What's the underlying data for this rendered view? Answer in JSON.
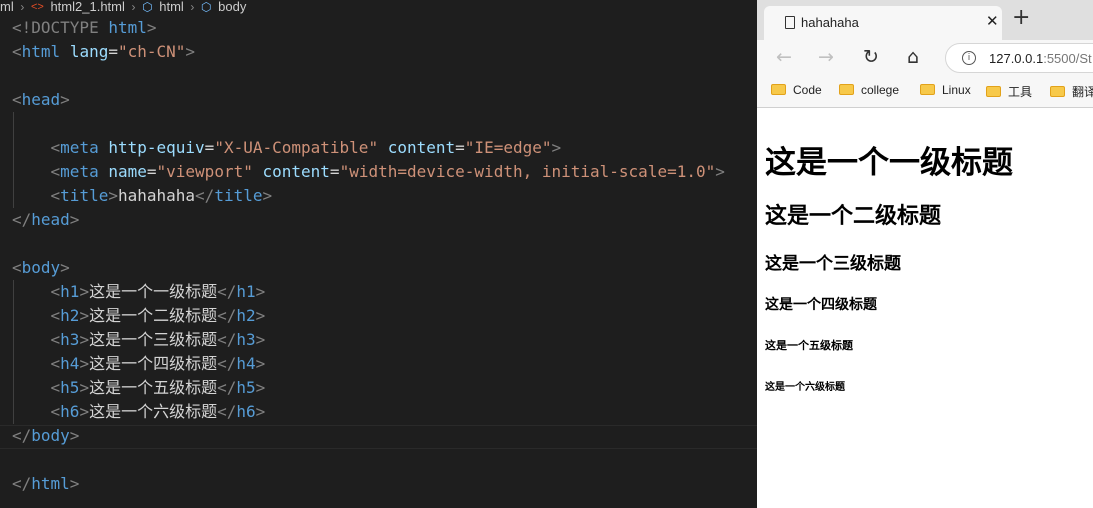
{
  "editor": {
    "breadcrumb": {
      "root": "ml",
      "file": "html2_1.html",
      "html": "html",
      "body": "body"
    },
    "lines": [
      [
        {
          "c": "t-br",
          "t": "<!DOCTYPE "
        },
        {
          "c": "t-tag",
          "t": "html"
        },
        {
          "c": "t-br",
          "t": ">"
        }
      ],
      [
        {
          "c": "t-br",
          "t": "<"
        },
        {
          "c": "t-tag",
          "t": "html"
        },
        {
          "c": "t-text",
          "t": " "
        },
        {
          "c": "t-attr",
          "t": "lang"
        },
        {
          "c": "t-text",
          "t": "="
        },
        {
          "c": "t-str",
          "t": "\"ch-CN\""
        },
        {
          "c": "t-br",
          "t": ">"
        }
      ],
      [],
      [
        {
          "c": "t-br",
          "t": "<"
        },
        {
          "c": "t-tag",
          "t": "head"
        },
        {
          "c": "t-br",
          "t": ">"
        }
      ],
      [],
      [
        {
          "c": "t-text",
          "t": "    "
        },
        {
          "c": "t-br",
          "t": "<"
        },
        {
          "c": "t-tag",
          "t": "meta"
        },
        {
          "c": "t-text",
          "t": " "
        },
        {
          "c": "t-attr",
          "t": "http-equiv"
        },
        {
          "c": "t-text",
          "t": "="
        },
        {
          "c": "t-str",
          "t": "\"X-UA-Compatible\""
        },
        {
          "c": "t-text",
          "t": " "
        },
        {
          "c": "t-attr",
          "t": "content"
        },
        {
          "c": "t-text",
          "t": "="
        },
        {
          "c": "t-str",
          "t": "\"IE=edge\""
        },
        {
          "c": "t-br",
          "t": ">"
        }
      ],
      [
        {
          "c": "t-text",
          "t": "    "
        },
        {
          "c": "t-br",
          "t": "<"
        },
        {
          "c": "t-tag",
          "t": "meta"
        },
        {
          "c": "t-text",
          "t": " "
        },
        {
          "c": "t-attr",
          "t": "name"
        },
        {
          "c": "t-text",
          "t": "="
        },
        {
          "c": "t-str",
          "t": "\"viewport\""
        },
        {
          "c": "t-text",
          "t": " "
        },
        {
          "c": "t-attr",
          "t": "content"
        },
        {
          "c": "t-text",
          "t": "="
        },
        {
          "c": "t-str",
          "t": "\"width=device-width, initial-scale=1.0\""
        },
        {
          "c": "t-br",
          "t": ">"
        }
      ],
      [
        {
          "c": "t-text",
          "t": "    "
        },
        {
          "c": "t-br",
          "t": "<"
        },
        {
          "c": "t-tag",
          "t": "title"
        },
        {
          "c": "t-br",
          "t": ">"
        },
        {
          "c": "t-text",
          "t": "hahahaha"
        },
        {
          "c": "t-br",
          "t": "</"
        },
        {
          "c": "t-tag",
          "t": "title"
        },
        {
          "c": "t-br",
          "t": ">"
        }
      ],
      [
        {
          "c": "t-br",
          "t": "</"
        },
        {
          "c": "t-tag",
          "t": "head"
        },
        {
          "c": "t-br",
          "t": ">"
        }
      ],
      [],
      [
        {
          "c": "t-br",
          "t": "<"
        },
        {
          "c": "t-tag",
          "t": "body"
        },
        {
          "c": "t-br",
          "t": ">"
        }
      ],
      [
        {
          "c": "t-text",
          "t": "    "
        },
        {
          "c": "t-br",
          "t": "<"
        },
        {
          "c": "t-tag",
          "t": "h1"
        },
        {
          "c": "t-br",
          "t": ">"
        },
        {
          "c": "t-text",
          "t": "这是一个一级标题"
        },
        {
          "c": "t-br",
          "t": "</"
        },
        {
          "c": "t-tag",
          "t": "h1"
        },
        {
          "c": "t-br",
          "t": ">"
        }
      ],
      [
        {
          "c": "t-text",
          "t": "    "
        },
        {
          "c": "t-br",
          "t": "<"
        },
        {
          "c": "t-tag",
          "t": "h2"
        },
        {
          "c": "t-br",
          "t": ">"
        },
        {
          "c": "t-text",
          "t": "这是一个二级标题"
        },
        {
          "c": "t-br",
          "t": "</"
        },
        {
          "c": "t-tag",
          "t": "h2"
        },
        {
          "c": "t-br",
          "t": ">"
        }
      ],
      [
        {
          "c": "t-text",
          "t": "    "
        },
        {
          "c": "t-br",
          "t": "<"
        },
        {
          "c": "t-tag",
          "t": "h3"
        },
        {
          "c": "t-br",
          "t": ">"
        },
        {
          "c": "t-text",
          "t": "这是一个三级标题"
        },
        {
          "c": "t-br",
          "t": "</"
        },
        {
          "c": "t-tag",
          "t": "h3"
        },
        {
          "c": "t-br",
          "t": ">"
        }
      ],
      [
        {
          "c": "t-text",
          "t": "    "
        },
        {
          "c": "t-br",
          "t": "<"
        },
        {
          "c": "t-tag",
          "t": "h4"
        },
        {
          "c": "t-br",
          "t": ">"
        },
        {
          "c": "t-text",
          "t": "这是一个四级标题"
        },
        {
          "c": "t-br",
          "t": "</"
        },
        {
          "c": "t-tag",
          "t": "h4"
        },
        {
          "c": "t-br",
          "t": ">"
        }
      ],
      [
        {
          "c": "t-text",
          "t": "    "
        },
        {
          "c": "t-br",
          "t": "<"
        },
        {
          "c": "t-tag",
          "t": "h5"
        },
        {
          "c": "t-br",
          "t": ">"
        },
        {
          "c": "t-text",
          "t": "这是一个五级标题"
        },
        {
          "c": "t-br",
          "t": "</"
        },
        {
          "c": "t-tag",
          "t": "h5"
        },
        {
          "c": "t-br",
          "t": ">"
        }
      ],
      [
        {
          "c": "t-text",
          "t": "    "
        },
        {
          "c": "t-br",
          "t": "<"
        },
        {
          "c": "t-tag",
          "t": "h6"
        },
        {
          "c": "t-br",
          "t": ">"
        },
        {
          "c": "t-text",
          "t": "这是一个六级标题"
        },
        {
          "c": "t-br",
          "t": "</"
        },
        {
          "c": "t-tag",
          "t": "h6"
        },
        {
          "c": "t-br",
          "t": ">"
        }
      ],
      [
        {
          "c": "t-br",
          "t": "</"
        },
        {
          "c": "t-tag",
          "t": "body"
        },
        {
          "c": "t-br",
          "t": ">"
        }
      ],
      [],
      [
        {
          "c": "t-br",
          "t": "</"
        },
        {
          "c": "t-tag",
          "t": "html"
        },
        {
          "c": "t-br",
          "t": ">"
        }
      ]
    ]
  },
  "browser": {
    "tab_title": "hahahaha",
    "tab_close": "✕",
    "new_tab": "+",
    "url_host": "127.0.0.1",
    "url_rest": ":5500/St",
    "bookmarks": [
      "Code",
      "college",
      "Linux",
      "工具",
      "翻译"
    ],
    "headings": {
      "h1": "这是一个一级标题",
      "h2": "这是一个二级标题",
      "h3": "这是一个三级标题",
      "h4": "这是一个四级标题",
      "h5": "这是一个五级标题",
      "h6": "这是一个六级标题"
    }
  },
  "colors": {
    "editor_bg": "#1e1e1e",
    "tag": "#569cd6",
    "attr": "#9cdcfe",
    "string": "#ce9178",
    "bracket": "#808080",
    "text": "#d4d4d4"
  }
}
